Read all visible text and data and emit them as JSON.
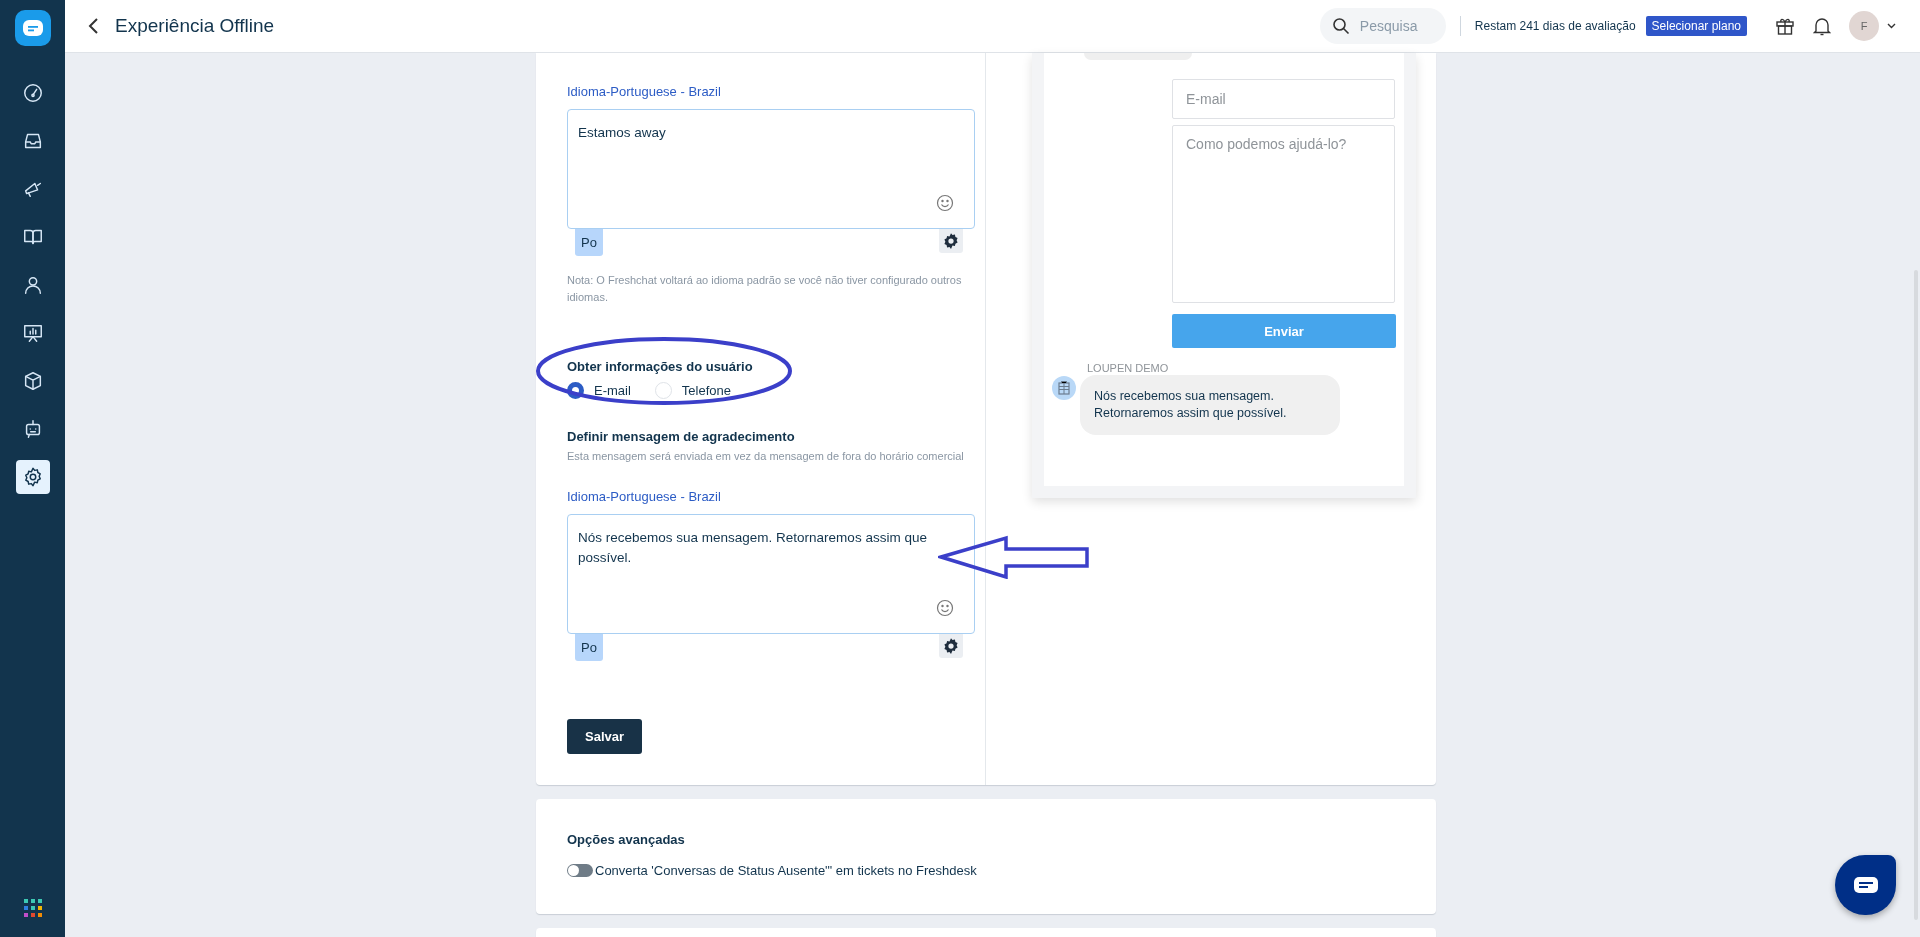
{
  "sidebar": {
    "items": [
      {
        "kind": "gauge",
        "selected": false
      },
      {
        "kind": "inbox",
        "selected": false
      },
      {
        "kind": "megaphone",
        "selected": false
      },
      {
        "kind": "book",
        "selected": false
      },
      {
        "kind": "person",
        "selected": false
      },
      {
        "kind": "presentation",
        "selected": false
      },
      {
        "kind": "cube",
        "selected": false
      },
      {
        "kind": "bot",
        "selected": false
      },
      {
        "kind": "gear",
        "selected": true
      }
    ]
  },
  "header": {
    "title": "Experiência Offline",
    "search": {
      "placeholder": "Pesquisa"
    },
    "trial_text": "Restam 241 dias de avaliação",
    "plan_button": "Selecionar plano",
    "avatar_initial": "F"
  },
  "offline_form": {
    "away_language": "Idioma-Portuguese - Brazil",
    "away_message": "Estamos away",
    "away_lang_tag": "Po",
    "note": "Nota: O Freshchat voltará ao idioma padrão se você não tiver configurado outros idiomas.",
    "user_info": {
      "label": "Obter informações do usuário",
      "options": [
        {
          "label": "E-mail",
          "selected": true
        },
        {
          "label": "Telefone",
          "selected": false
        }
      ]
    },
    "thanks": {
      "label": "Definir mensagem de agradecimento",
      "hint": "Esta mensagem será enviada em vez da mensagem de fora do horário comercial",
      "language": "Idioma-Portuguese - Brazil",
      "message": "Nós recebemos sua mensagem. Retornaremos assim que possível.",
      "lang_tag": "Po"
    },
    "save_button": "Salvar"
  },
  "preview": {
    "email_placeholder": "E-mail",
    "message_placeholder": "Como podemos ajudá-lo?",
    "send_button": "Enviar",
    "agent_name": "LOUPEN DEMO",
    "agent_message": "Nós recebemos sua mensagem. Retornaremos assim que possível."
  },
  "advanced": {
    "title": "Opções avançadas",
    "toggle": {
      "label": "Converta 'Conversas de Status Ausente'\" em tickets no Freshdesk",
      "on": false
    }
  }
}
